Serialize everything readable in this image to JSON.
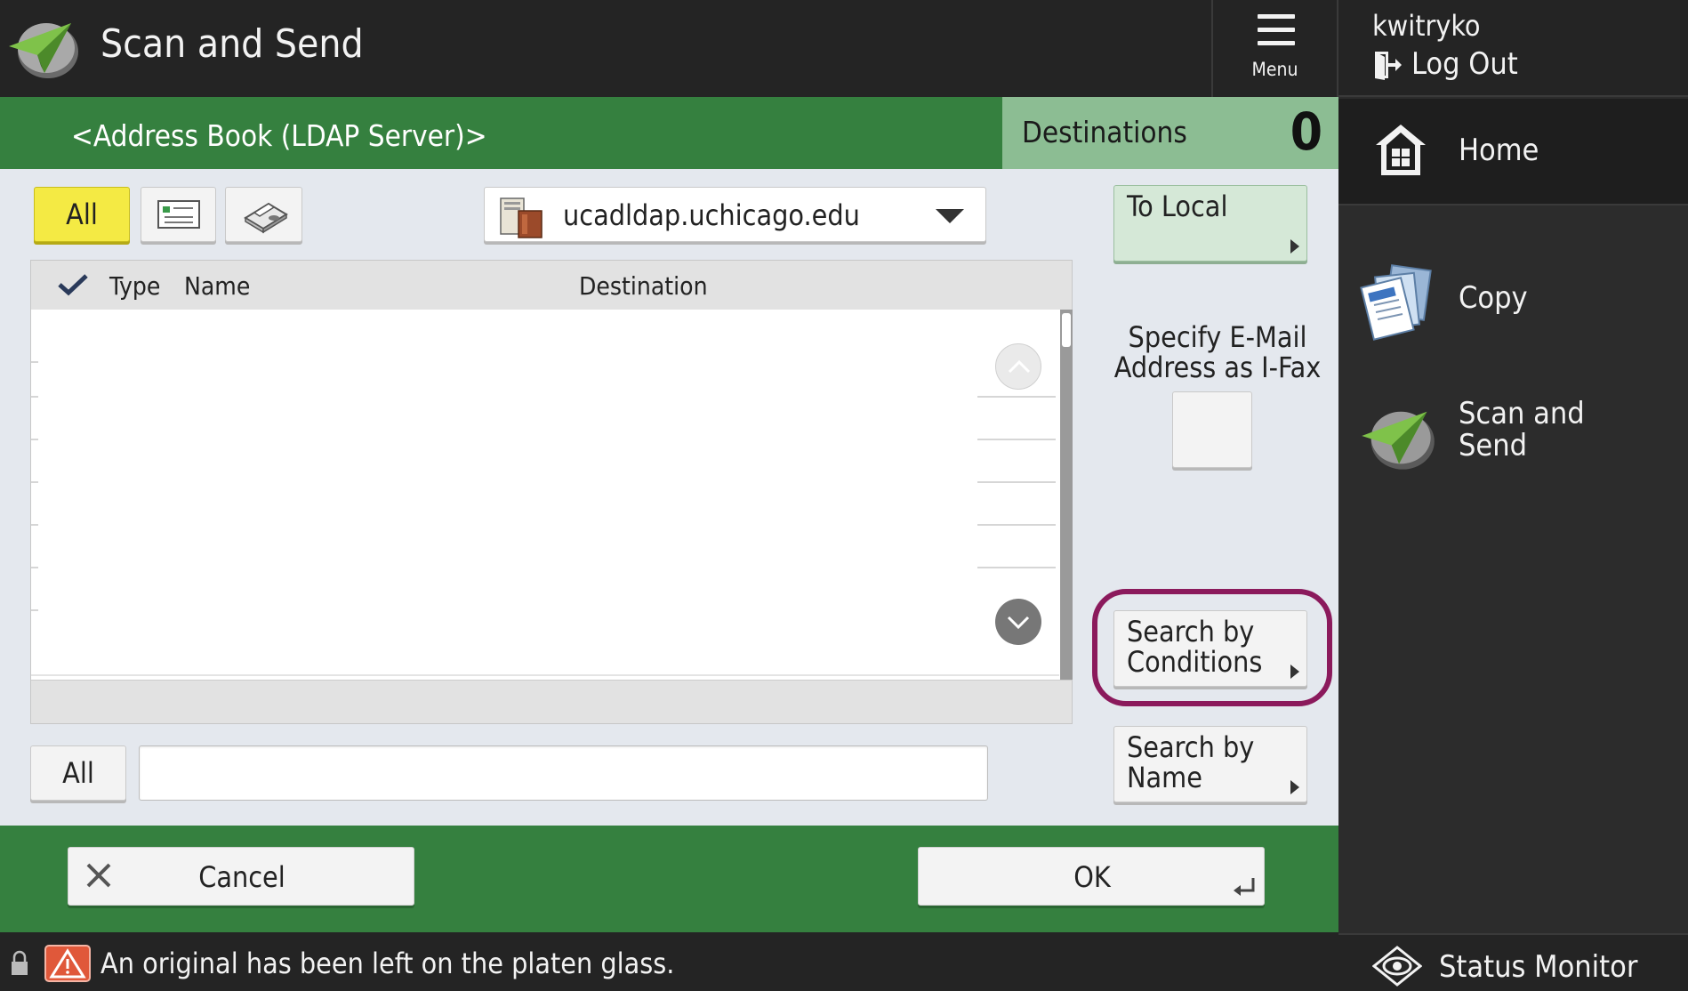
{
  "header": {
    "title": "Scan and Send",
    "menu_label": "Menu"
  },
  "user": {
    "name": "kwitryko",
    "logout_label": "Log Out"
  },
  "side_nav": {
    "home": "Home",
    "copy": "Copy",
    "scan_send": "Scan and\nSend",
    "status_monitor": "Status Monitor"
  },
  "address_book": {
    "title": "<Address Book (LDAP Server)>",
    "destinations_label": "Destinations",
    "destinations_count": "0"
  },
  "filters": {
    "all_label": "All",
    "email_icon": "email-card-icon",
    "fax_icon": "fax-icon"
  },
  "server": {
    "selected": "ucadldap.uchicago.edu",
    "icon": "ldap-server-icon"
  },
  "list": {
    "columns": [
      "Type",
      "Name",
      "Destination"
    ],
    "rows": []
  },
  "search": {
    "prefix_label": "All",
    "value": "",
    "placeholder": ""
  },
  "side_buttons": {
    "to_local": "To Local",
    "ifax_label": "Specify E-Mail\nAddress as I-Fax",
    "search_conditions": "Search by\nConditions",
    "search_name": "Search by\nName"
  },
  "actions": {
    "cancel": "Cancel",
    "ok": "OK"
  },
  "status": {
    "message": "An original has been left on the platen glass."
  },
  "colors": {
    "header_bg": "#242424",
    "green_bar": "#35803f",
    "destinations_bg": "#8cbd93",
    "all_filter_yellow": "#f4ea44",
    "highlight_ring": "#8b1a5c",
    "to_local_bg": "#d5e8d7"
  }
}
